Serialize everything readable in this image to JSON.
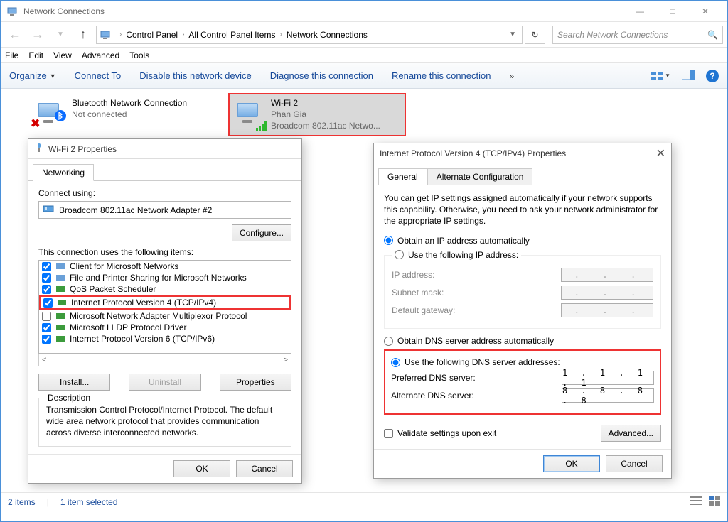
{
  "window": {
    "title": "Network Connections"
  },
  "breadcrumb": {
    "items": [
      "Control Panel",
      "All Control Panel Items",
      "Network Connections"
    ]
  },
  "search": {
    "placeholder": "Search Network Connections"
  },
  "menubar": [
    "File",
    "Edit",
    "View",
    "Advanced",
    "Tools"
  ],
  "cmdbar": {
    "organize": "Organize",
    "items": [
      "Connect To",
      "Disable this network device",
      "Diagnose this connection",
      "Rename this connection"
    ]
  },
  "adapters": [
    {
      "name": "Bluetooth Network Connection",
      "status": "Not connected",
      "detail": ""
    },
    {
      "name": "Wi-Fi 2",
      "status": "Phan Gia",
      "detail": "Broadcom 802.11ac Netwo..."
    }
  ],
  "statusbar": {
    "items_count": "2 items",
    "selection": "1 item selected"
  },
  "props_dialog": {
    "title": "Wi-Fi 2 Properties",
    "tab": "Networking",
    "connect_using_label": "Connect using:",
    "adapter": "Broadcom 802.11ac Network Adapter #2",
    "configure_btn": "Configure...",
    "items_label": "This connection uses the following items:",
    "items": [
      {
        "checked": true,
        "label": "Client for Microsoft Networks"
      },
      {
        "checked": true,
        "label": "File and Printer Sharing for Microsoft Networks"
      },
      {
        "checked": true,
        "label": "QoS Packet Scheduler"
      },
      {
        "checked": true,
        "label": "Internet Protocol Version 4 (TCP/IPv4)",
        "highlight": true
      },
      {
        "checked": false,
        "label": "Microsoft Network Adapter Multiplexor Protocol"
      },
      {
        "checked": true,
        "label": "Microsoft LLDP Protocol Driver"
      },
      {
        "checked": true,
        "label": "Internet Protocol Version 6 (TCP/IPv6)"
      }
    ],
    "install_btn": "Install...",
    "uninstall_btn": "Uninstall",
    "properties_btn": "Properties",
    "desc_legend": "Description",
    "desc_text": "Transmission Control Protocol/Internet Protocol. The default wide area network protocol that provides communication across diverse interconnected networks.",
    "ok": "OK",
    "cancel": "Cancel"
  },
  "ipv4_dialog": {
    "title": "Internet Protocol Version 4 (TCP/IPv4) Properties",
    "tabs": [
      "General",
      "Alternate Configuration"
    ],
    "help_text": "You can get IP settings assigned automatically if your network supports this capability. Otherwise, you need to ask your network administrator for the appropriate IP settings.",
    "radio_auto_ip": "Obtain an IP address automatically",
    "radio_static_ip": "Use the following IP address:",
    "ip_labels": {
      "ip": "IP address:",
      "mask": "Subnet mask:",
      "gw": "Default gateway:"
    },
    "radio_auto_dns": "Obtain DNS server address automatically",
    "radio_static_dns": "Use the following DNS server addresses:",
    "dns_labels": {
      "pref": "Preferred DNS server:",
      "alt": "Alternate DNS server:"
    },
    "dns_values": {
      "pref": "1 . 1 . 1 . 1",
      "alt": "8 . 8 . 8 . 8"
    },
    "validate": "Validate settings upon exit",
    "advanced": "Advanced...",
    "ok": "OK",
    "cancel": "Cancel"
  }
}
